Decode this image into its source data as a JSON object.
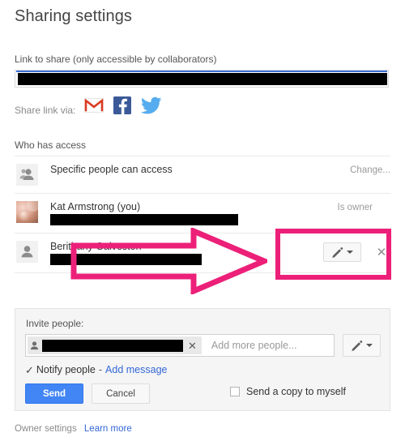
{
  "page": {
    "title": "Sharing settings"
  },
  "link_section": {
    "label": "Link to share (only accessible by collaborators)",
    "value_redacted": true,
    "share_via_label": "Share link via:",
    "social": [
      {
        "name": "gmail-icon",
        "label": "Gmail"
      },
      {
        "name": "facebook-icon",
        "label": "Facebook"
      },
      {
        "name": "twitter-icon",
        "label": "Twitter"
      }
    ]
  },
  "access_section": {
    "heading": "Who has access",
    "rows": [
      {
        "icon": "people-icon",
        "name": "Specific people can access",
        "email_redacted": false,
        "right_text": "Change...",
        "right_type": "link"
      },
      {
        "icon": "avatar-photo",
        "name": "Kat Armstrong (you)",
        "email_redacted": true,
        "right_text": "Is owner",
        "right_type": "text"
      },
      {
        "icon": "person-icon",
        "name": "Berithany Galveston",
        "email_redacted": true,
        "right_text": "",
        "right_type": "permission",
        "permission_icon": "pencil-icon",
        "remove_icon": "close-icon"
      }
    ]
  },
  "invite_section": {
    "label": "Invite people:",
    "chip_redacted": true,
    "chip_remove_icon": "close-icon",
    "placeholder": "Add more people...",
    "permission_icon": "pencil-icon",
    "notify_checked": true,
    "notify_label": "Notify people",
    "notify_separator": "-",
    "add_message_link": "Add message",
    "send_label": "Send",
    "cancel_label": "Cancel",
    "copy_checked": false,
    "copy_label": "Send a copy to myself"
  },
  "footer": {
    "owner_settings": "Owner settings",
    "learn_more": "Learn more"
  },
  "annotations": {
    "color": "#ec2079",
    "arrow": "right-arrow-annotation",
    "rect": "highlight-rectangle-annotation"
  },
  "colors": {
    "accent_blue": "#4285f4",
    "link_blue": "#3367d6",
    "annotation_pink": "#ec2079",
    "panel_bg": "#f5f5f5"
  }
}
